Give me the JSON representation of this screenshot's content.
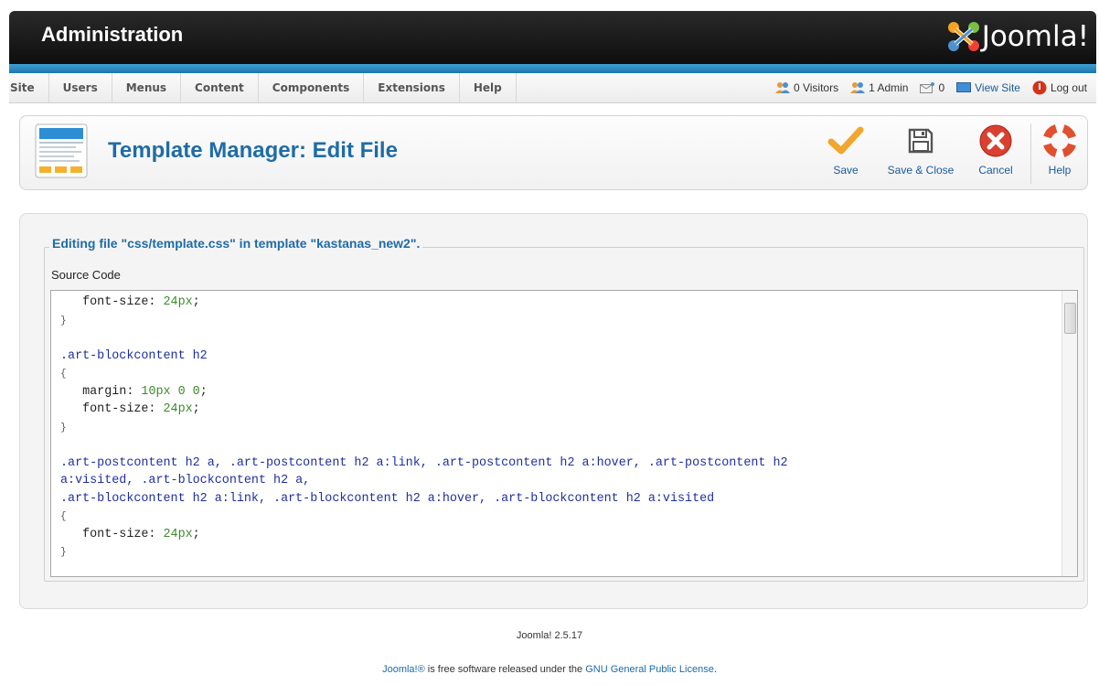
{
  "header": {
    "title": "Administration",
    "brand": "Joomla!"
  },
  "menu": {
    "items": [
      "Site",
      "Users",
      "Menus",
      "Content",
      "Components",
      "Extensions",
      "Help"
    ]
  },
  "status": {
    "visitors": "0 Visitors",
    "admins": "1 Admin",
    "messages": "0",
    "view_site": "View Site",
    "logout": "Log out"
  },
  "toolbar": {
    "title": "Template Manager: Edit File",
    "buttons": {
      "save": "Save",
      "save_close": "Save & Close",
      "cancel": "Cancel",
      "help": "Help"
    }
  },
  "editor": {
    "legend": "Editing file \"css/template.css\" in template \"kastanas_new2\".",
    "source_label": "Source Code",
    "lines": [
      [
        [
          "prop",
          "   font-size: "
        ],
        [
          "val",
          "24px"
        ],
        [
          "prop",
          ";"
        ]
      ],
      [
        [
          "brace",
          "}"
        ]
      ],
      [],
      [
        [
          "sel",
          ".art-blockcontent h2"
        ]
      ],
      [
        [
          "brace",
          "{"
        ]
      ],
      [
        [
          "prop",
          "   margin: "
        ],
        [
          "val",
          "10px 0 0"
        ],
        [
          "prop",
          ";"
        ]
      ],
      [
        [
          "prop",
          "   font-size: "
        ],
        [
          "val",
          "24px"
        ],
        [
          "prop",
          ";"
        ]
      ],
      [
        [
          "brace",
          "}"
        ]
      ],
      [],
      [
        [
          "sel",
          ".art-postcontent h2 a, .art-postcontent h2 a:link, .art-postcontent h2 a:hover, .art-postcontent h2"
        ]
      ],
      [
        [
          "sel",
          "a:visited, .art-blockcontent h2 a,"
        ]
      ],
      [
        [
          "sel",
          ".art-blockcontent h2 a:link, .art-blockcontent h2 a:hover, .art-blockcontent h2 a:visited"
        ]
      ],
      [
        [
          "brace",
          "{"
        ]
      ],
      [
        [
          "prop",
          "   font-size: "
        ],
        [
          "val",
          "24px"
        ],
        [
          "prop",
          ";"
        ]
      ],
      [
        [
          "brace",
          "}"
        ]
      ]
    ]
  },
  "footer": {
    "version": "Joomla! 2.5.17",
    "license_prefix": "Joomla!®",
    "license_middle": " is free software released under the ",
    "license_link": "GNU General Public License",
    "license_suffix": "."
  },
  "colors": {
    "accent_blue": "#1f6ca5",
    "header_dark": "#111111",
    "code_selector": "#1f2f9f",
    "code_value": "#3c8a2c"
  }
}
